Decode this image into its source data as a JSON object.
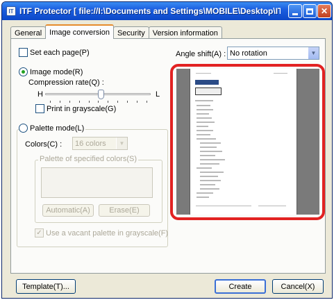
{
  "window": {
    "title": "ITF Protector [ file://I:\\Documents and Settings\\MOBILE\\Desktop\\ITF-file\\...",
    "app_icon_glyph": "IT"
  },
  "tabs": [
    {
      "label": "General",
      "active": false
    },
    {
      "label": "Image conversion",
      "active": true
    },
    {
      "label": "Security",
      "active": false
    },
    {
      "label": "Version information",
      "active": false
    }
  ],
  "options": {
    "set_each_page_label": "Set each page(P)",
    "angle_shift_label": "Angle shift(A) :",
    "angle_shift_value": "No rotation"
  },
  "image_mode": {
    "label": "Image mode(R)",
    "selected": true,
    "compression_label": "Compression rate(Q) :",
    "slider_low": "H",
    "slider_high": "L",
    "slider_position": 0.53,
    "grayscale_label": "Print in grayscale(G)"
  },
  "palette_mode": {
    "label": "Palette mode(L)",
    "selected": false,
    "colors_label": "Colors(C) :",
    "colors_value": "16 colors",
    "group_label": "Palette of specified colors(S)",
    "automatic_button": "Automatic(A)",
    "erase_button": "Erase(E)",
    "vacant_palette_label": "Use a vacant palette in grayscale(F)"
  },
  "footer": {
    "template_button": "Template(T)...",
    "create_button": "Create",
    "cancel_button": "Cancel(X)"
  },
  "colors": {
    "title_bar": "#1c5fe0",
    "highlight_ring": "#e22222",
    "preview_background": "#7a7a7a"
  }
}
